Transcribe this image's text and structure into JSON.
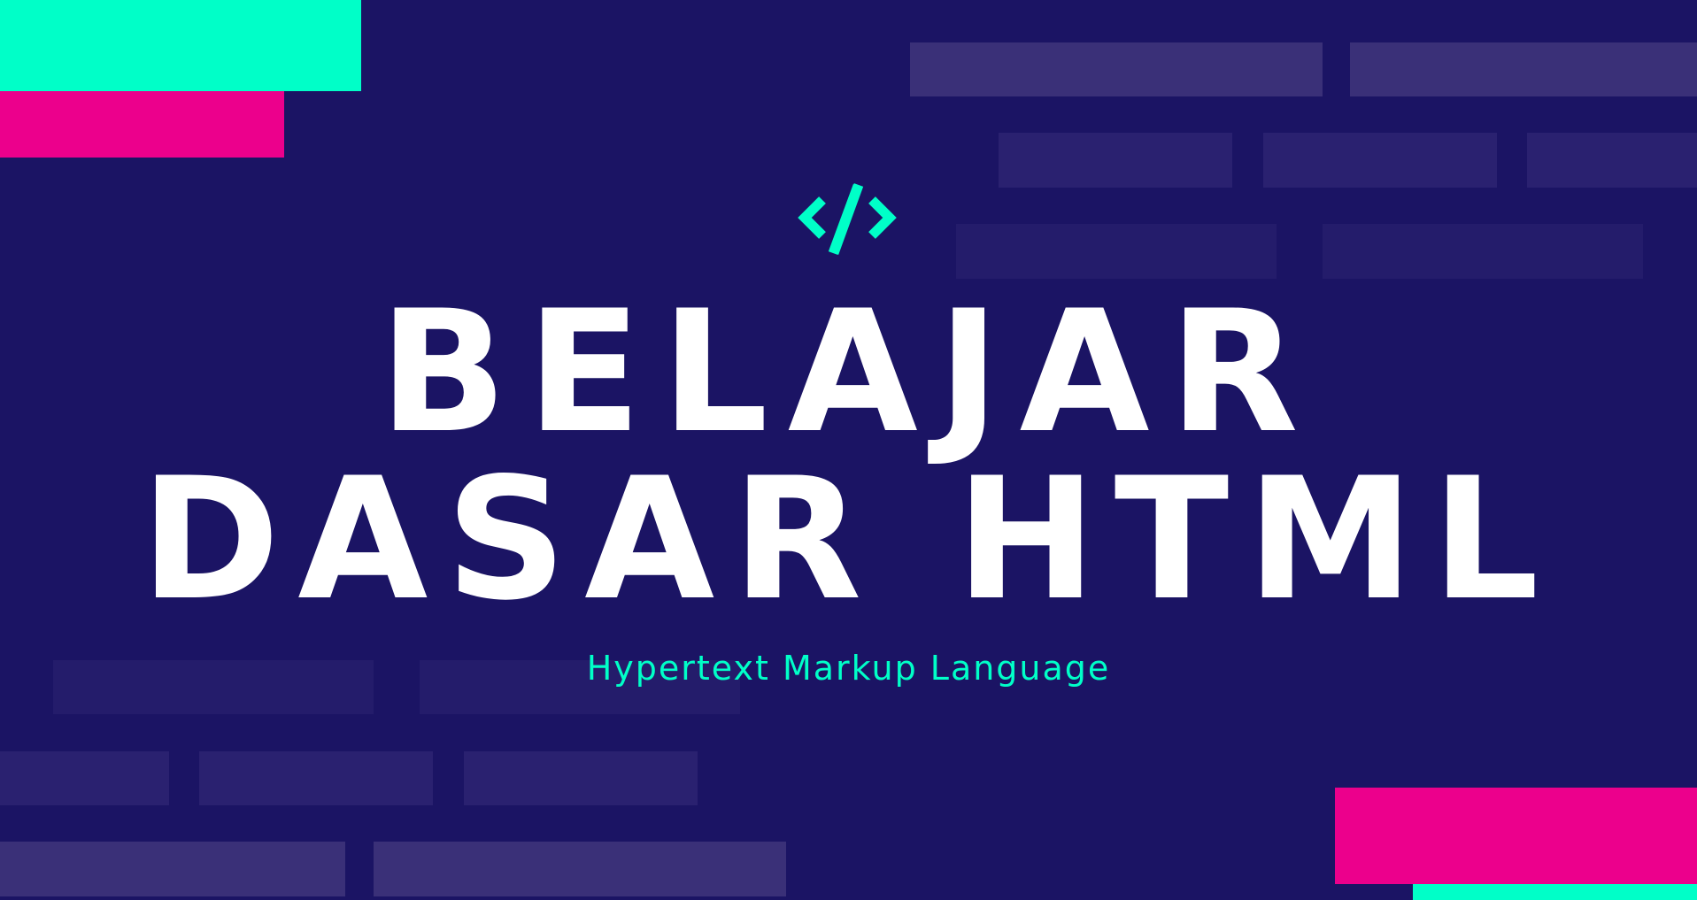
{
  "title_line_1": "BELAJAR",
  "title_line_2": "DASAR HTML",
  "subtitle": "Hypertext Markup Language",
  "icon": "code-icon",
  "colors": {
    "background": "#1b1464",
    "accent_teal": "#00ffc8",
    "accent_pink": "#ec008c",
    "title_text": "#ffffff"
  }
}
